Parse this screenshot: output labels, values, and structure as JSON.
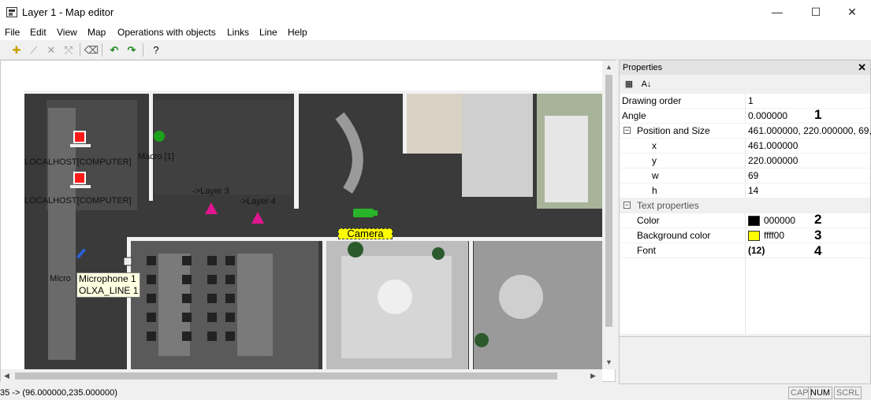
{
  "window": {
    "title": "Layer 1 - Map editor",
    "minimize": "—",
    "maximize": "☐",
    "close": "✕"
  },
  "menu": [
    "File",
    "Edit",
    "View",
    "Map",
    "Operations with objects",
    "Links",
    "Line",
    "Help"
  ],
  "toolbar": {
    "icons": [
      "add-object-icon",
      "draw-line-icon",
      "delete-icon",
      "connect-icon",
      "eraser-icon",
      "undo-icon",
      "redo-icon",
      "help-icon"
    ],
    "help_label": "?"
  },
  "map": {
    "labels": {
      "computer1": "LOCALHOST[COMPUTER]",
      "computer2": "LOCALHOST[COMPUTER]",
      "macro": "Macro [1]",
      "layer3": "->Layer 3",
      "layer4": "->Layer 4",
      "mic_partial": "Micro"
    },
    "tooltip_lines": [
      "Microphone 1",
      "OLXA_LINE 1"
    ],
    "camera_label": "Camera"
  },
  "properties": {
    "title": "Properties",
    "close": "✕",
    "rows": {
      "drawing_order": {
        "label": "Drawing order",
        "value": "1"
      },
      "angle": {
        "label": "Angle",
        "value": "0.000000",
        "marker": "1"
      },
      "pos_size": {
        "label": "Position and Size",
        "value": "461.000000, 220.000000, 69,..."
      },
      "x": {
        "label": "x",
        "value": "461.000000"
      },
      "y": {
        "label": "y",
        "value": "220.000000"
      },
      "w": {
        "label": "w",
        "value": "69"
      },
      "h": {
        "label": "h",
        "value": "14"
      },
      "text_props": {
        "label": "Text properties"
      },
      "color": {
        "label": "Color",
        "value": "000000",
        "swatch": "#000000",
        "marker": "2"
      },
      "bg_color": {
        "label": "Background color",
        "value": "ffff00",
        "swatch": "#ffff00",
        "marker": "3"
      },
      "font": {
        "label": "Font",
        "value": "(12)",
        "marker": "4"
      }
    }
  },
  "status": {
    "text": "35 -> (96.000000,235.000000)",
    "indicators": [
      "CAP",
      "NUM",
      "SCRL"
    ]
  }
}
